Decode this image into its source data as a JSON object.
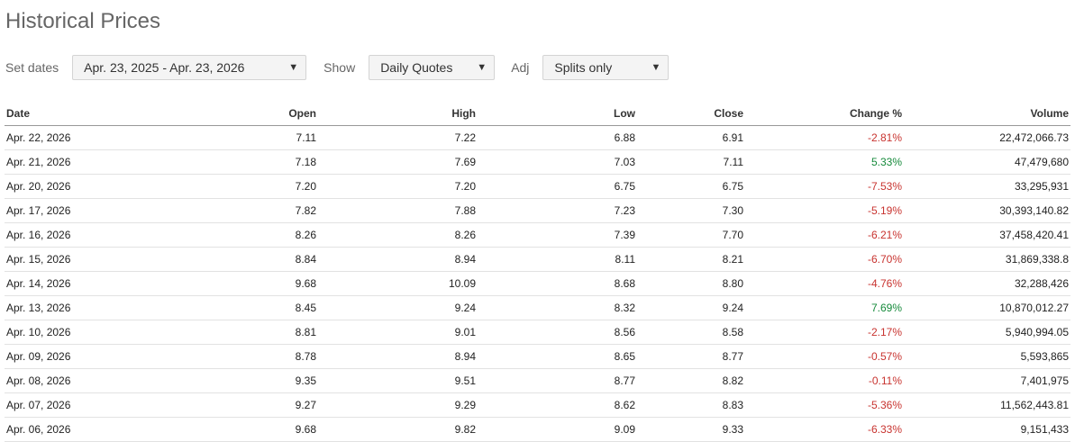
{
  "page": {
    "title": "Historical Prices"
  },
  "controls": {
    "set_dates_label": "Set dates",
    "date_range_value": "Apr. 23, 2025 - Apr. 23, 2026",
    "show_label": "Show",
    "show_value": "Daily Quotes",
    "adj_label": "Adj",
    "adj_value": "Splits only"
  },
  "colors": {
    "negative": "#c8332f",
    "positive": "#168a3b"
  },
  "table": {
    "headers": [
      "Date",
      "Open",
      "High",
      "Low",
      "Close",
      "Change %",
      "Volume"
    ],
    "rows": [
      [
        "Apr. 22, 2026",
        "7.11",
        "7.22",
        "6.88",
        "6.91",
        "-2.81%",
        "22,472,066.73"
      ],
      [
        "Apr. 21, 2026",
        "7.18",
        "7.69",
        "7.03",
        "7.11",
        "5.33%",
        "47,479,680"
      ],
      [
        "Apr. 20, 2026",
        "7.20",
        "7.20",
        "6.75",
        "6.75",
        "-7.53%",
        "33,295,931"
      ],
      [
        "Apr. 17, 2026",
        "7.82",
        "7.88",
        "7.23",
        "7.30",
        "-5.19%",
        "30,393,140.82"
      ],
      [
        "Apr. 16, 2026",
        "8.26",
        "8.26",
        "7.39",
        "7.70",
        "-6.21%",
        "37,458,420.41"
      ],
      [
        "Apr. 15, 2026",
        "8.84",
        "8.94",
        "8.11",
        "8.21",
        "-6.70%",
        "31,869,338.8"
      ],
      [
        "Apr. 14, 2026",
        "9.68",
        "10.09",
        "8.68",
        "8.80",
        "-4.76%",
        "32,288,426"
      ],
      [
        "Apr. 13, 2026",
        "8.45",
        "9.24",
        "8.32",
        "9.24",
        "7.69%",
        "10,870,012.27"
      ],
      [
        "Apr. 10, 2026",
        "8.81",
        "9.01",
        "8.56",
        "8.58",
        "-2.17%",
        "5,940,994.05"
      ],
      [
        "Apr. 09, 2026",
        "8.78",
        "8.94",
        "8.65",
        "8.77",
        "-0.57%",
        "5,593,865"
      ],
      [
        "Apr. 08, 2026",
        "9.35",
        "9.51",
        "8.77",
        "8.82",
        "-0.11%",
        "7,401,975"
      ],
      [
        "Apr. 07, 2026",
        "9.27",
        "9.29",
        "8.62",
        "8.83",
        "-5.36%",
        "11,562,443.81"
      ],
      [
        "Apr. 06, 2026",
        "9.68",
        "9.82",
        "9.09",
        "9.33",
        "-6.33%",
        "9,151,433"
      ]
    ]
  }
}
